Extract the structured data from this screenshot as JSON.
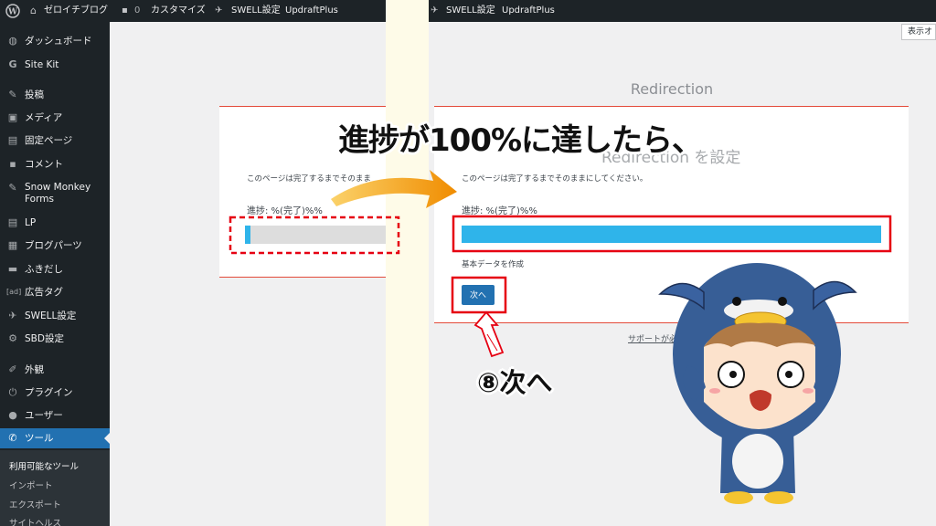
{
  "adminbar": {
    "site_name": "ゼロイチブログ",
    "comments_count": "0",
    "customize": "カスタマイズ",
    "swell_settings": "SWELL設定",
    "updraft": "UpdraftPlus",
    "screen_options": "表示オ"
  },
  "sidebar": {
    "items": [
      {
        "label": "ダッシュボード",
        "icon": "dashboard-icon"
      },
      {
        "label": "Site Kit",
        "icon": "site-kit-icon"
      },
      {
        "label": "投稿",
        "icon": "pin-icon"
      },
      {
        "label": "メディア",
        "icon": "media-icon"
      },
      {
        "label": "固定ページ",
        "icon": "page-icon"
      },
      {
        "label": "コメント",
        "icon": "comment-icon"
      },
      {
        "label": "Snow Monkey Forms",
        "icon": "pin-icon"
      },
      {
        "label": "LP",
        "icon": "page-icon"
      },
      {
        "label": "ブログパーツ",
        "icon": "blocks-icon"
      },
      {
        "label": "ふきだし",
        "icon": "balloon-icon"
      },
      {
        "label": "広告タグ",
        "icon": "ad-icon"
      },
      {
        "label": "SWELL設定",
        "icon": "swell-icon"
      },
      {
        "label": "SBD設定",
        "icon": "gear-icon"
      },
      {
        "label": "外観",
        "icon": "brush-icon"
      },
      {
        "label": "プラグイン",
        "icon": "plugin-icon"
      },
      {
        "label": "ユーザー",
        "icon": "user-icon"
      },
      {
        "label": "ツール",
        "icon": "wrench-icon"
      }
    ],
    "submenu": [
      "利用可能なツール",
      "インポート",
      "エクスポート",
      "サイトヘルス"
    ]
  },
  "before": {
    "description": "このページは完了するまでそのまま",
    "progress_label": "進捗: %(完了)%%",
    "progress": 0.04
  },
  "after": {
    "page_title": "Redirection",
    "settings_heading": "Redirection を設定",
    "description": "このページは完了するまでそのままにしてください。",
    "progress_label": "進捗: %(完了)%%",
    "progress": 1.0,
    "status": "基本データを作成",
    "next_button": "次へ",
    "support": "サポートが必要で..."
  },
  "annotations": {
    "headline": "進捗が100%に達したら、",
    "step": "⑧次へ"
  },
  "colors": {
    "admin_dark": "#1d2327",
    "accent_blue": "#2271b1",
    "progress_blue": "#2fb4ea",
    "highlight_red": "#e60012",
    "arrow_orange": "#f39800"
  }
}
